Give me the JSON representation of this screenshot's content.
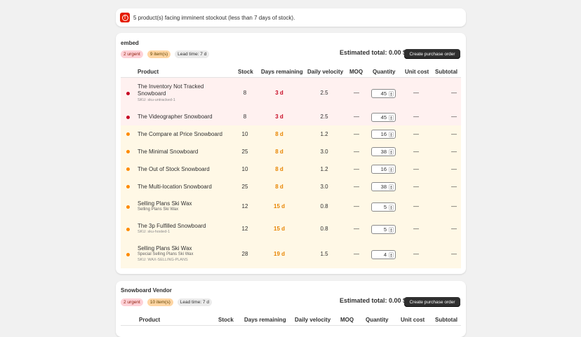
{
  "banner": {
    "icon": "alert-circle-icon",
    "text": "5 product(s) facing imminent stockout (less than 7 days of stock)."
  },
  "columns": [
    "Product",
    "Stock",
    "Days remaining",
    "Daily velocity",
    "MOQ",
    "Quantity",
    "Unit cost",
    "Subtotal"
  ],
  "vendors": [
    {
      "name": "embed",
      "badges": {
        "urgent": "2 urgent",
        "items": "9 item(s)",
        "lead": "Lead time: 7 d"
      },
      "estimated_total": "Estimated total: 0.00 $",
      "button": "Create purchase order",
      "rows": [
        {
          "level": "red",
          "name": "The Inventory Not Tracked Snowboard",
          "sub": "",
          "sku": "SKU: sku-untracked-1",
          "stock": "8",
          "days": "3 d",
          "velocity": "2.5",
          "moq": "—",
          "qty": "45",
          "unit_cost": "—",
          "subtotal": "—"
        },
        {
          "level": "red",
          "name": "The Videographer Snowboard",
          "sub": "",
          "sku": "",
          "stock": "8",
          "days": "3 d",
          "velocity": "2.5",
          "moq": "—",
          "qty": "45",
          "unit_cost": "—",
          "subtotal": "—"
        },
        {
          "level": "org",
          "name": "The Compare at Price Snowboard",
          "sub": "",
          "sku": "",
          "stock": "10",
          "days": "8 d",
          "velocity": "1.2",
          "moq": "—",
          "qty": "16",
          "unit_cost": "—",
          "subtotal": "—"
        },
        {
          "level": "org",
          "name": "The Minimal Snowboard",
          "sub": "",
          "sku": "",
          "stock": "25",
          "days": "8 d",
          "velocity": "3.0",
          "moq": "—",
          "qty": "38",
          "unit_cost": "—",
          "subtotal": "—"
        },
        {
          "level": "org",
          "name": "The Out of Stock Snowboard",
          "sub": "",
          "sku": "",
          "stock": "10",
          "days": "8 d",
          "velocity": "1.2",
          "moq": "—",
          "qty": "16",
          "unit_cost": "—",
          "subtotal": "—"
        },
        {
          "level": "org",
          "name": "The Multi-location Snowboard",
          "sub": "",
          "sku": "",
          "stock": "25",
          "days": "8 d",
          "velocity": "3.0",
          "moq": "—",
          "qty": "38",
          "unit_cost": "—",
          "subtotal": "—"
        },
        {
          "level": "org",
          "name": "Selling Plans Ski Wax",
          "sub": "Selling Plans Ski Wax",
          "sku": "",
          "stock": "12",
          "days": "15 d",
          "velocity": "0.8",
          "moq": "—",
          "qty": "5",
          "unit_cost": "—",
          "subtotal": "—"
        },
        {
          "level": "org",
          "name": "The 3p Fulfilled Snowboard",
          "sub": "",
          "sku": "SKU: sku-hosted-1",
          "stock": "12",
          "days": "15 d",
          "velocity": "0.8",
          "moq": "—",
          "qty": "5",
          "unit_cost": "—",
          "subtotal": "—"
        },
        {
          "level": "org",
          "name": "Selling Plans Ski Wax",
          "sub": "Special Selling Plans Ski Wax",
          "sku": "SKU: WAX-SELLING-PLANS",
          "stock": "28",
          "days": "19 d",
          "velocity": "1.5",
          "moq": "—",
          "qty": "4",
          "unit_cost": "—",
          "subtotal": "—"
        }
      ]
    },
    {
      "name": "Snowboard Vendor",
      "badges": {
        "urgent": "2 urgent",
        "items": "10 item(s)",
        "lead": "Lead time: 7 d"
      },
      "estimated_total": "Estimated total: 0.00 $",
      "button": "Create purchase order"
    }
  ]
}
